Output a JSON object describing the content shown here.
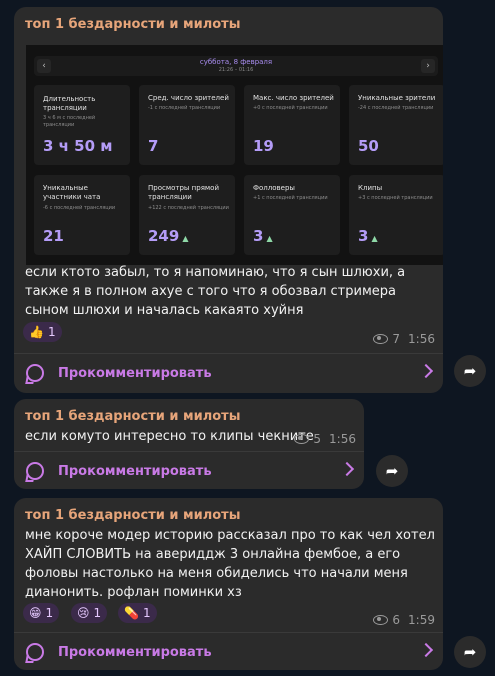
{
  "messages": [
    {
      "author": "топ 1 бездарности и милоты",
      "text": "если ктото забыл, то я напоминаю, что я сын шлюхи, а также я в полном ахуе с того что я обозвал стримера сыном шлюхи и началась какаято хуйня",
      "reactions": [
        {
          "emoji": "👍",
          "count": "1"
        }
      ],
      "views": "7",
      "time": "1:56",
      "comment_label": "Прокомментировать"
    },
    {
      "author": "топ 1 бездарности и милоты",
      "text": "если комуто интересно то клипы чекните",
      "views": "5",
      "time": "1:56",
      "comment_label": "Прокомментировать"
    },
    {
      "author": "топ 1 бездарности и милоты",
      "text": "мне короче модер историю рассказал про то как чел хотел ХАЙП СЛОВИТЬ на авериддж 3 онлайна фембое, а его фоловы настолько на меня обиделись что начали меня дианонить. рофлан поминки хз",
      "reactions": [
        {
          "emoji": "😁",
          "count": "1"
        },
        {
          "emoji": "😢",
          "count": "1"
        },
        {
          "emoji": "💊",
          "count": "1"
        }
      ],
      "views": "6",
      "time": "1:59",
      "comment_label": "Прокомментировать"
    }
  ],
  "stats_image": {
    "date": "суббота, 8 февраля",
    "time_range": "21:26 – 01:16",
    "nav_prev": "‹",
    "nav_next": "›",
    "cards": [
      {
        "title": "Длительность трансляции",
        "sub": "3 ч 6 м с последней трансляции",
        "value": "3 ч 50 м",
        "up": ""
      },
      {
        "title": "Сред. число зрителей",
        "sub": "-1 с последней трансляции",
        "value": "7",
        "up": ""
      },
      {
        "title": "Макс. число зрителей",
        "sub": "+0 с последней трансляции",
        "value": "19",
        "up": ""
      },
      {
        "title": "Уникальные зрители",
        "sub": "-24 с последней трансляции",
        "value": "50",
        "up": ""
      },
      {
        "title": "Уникальные участники чата",
        "sub": "-6 с последней трансляции",
        "value": "21",
        "up": ""
      },
      {
        "title": "Просмотры прямой трансляции",
        "sub": "+122 с последней трансляции",
        "value": "249",
        "up": "▲"
      },
      {
        "title": "Фолловеры",
        "sub": "+1 с последней трансляции",
        "value": "3",
        "up": "▲"
      },
      {
        "title": "Клипы",
        "sub": "+3 с последней трансляции",
        "value": "3",
        "up": "▲"
      }
    ]
  },
  "icons": {
    "share": "share-arrow-icon",
    "eye": "eye-icon",
    "comment": "comment-bubble-icon",
    "chevron": "chevron-right-icon"
  }
}
